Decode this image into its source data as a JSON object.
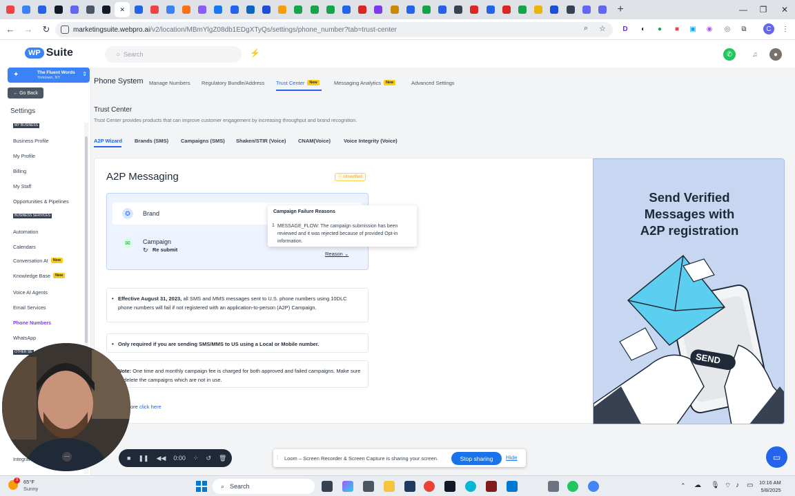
{
  "browser": {
    "url_host": "marketingsuite.webpro.ai",
    "url_path": "/v2/location/MBmYlgZ08db1EDgXTyQs/settings/phone_number?tab=trust-center",
    "tab_count": 38
  },
  "app": {
    "logo_badge": "WP",
    "logo_text": "Suite",
    "search_placeholder": "Search"
  },
  "sidebar": {
    "location_name": "The Fluent Words",
    "location_sub": "Yorktown, NY",
    "go_back": "Go Back",
    "settings_title": "Settings",
    "section_my_business": "MY BUSINESS",
    "section_business_services": "BUSINESS SERVICES",
    "section_other": "OTHER SE",
    "items": [
      {
        "label": "Business Profile"
      },
      {
        "label": "My Profile"
      },
      {
        "label": "Billing"
      },
      {
        "label": "My Staff"
      },
      {
        "label": "Opportunities & Pipelines"
      },
      {
        "label": "Automation"
      },
      {
        "label": "Calendars"
      },
      {
        "label": "Conversation AI",
        "badge": "New"
      },
      {
        "label": "Knowledge Base",
        "badge": "New"
      },
      {
        "label": "Voice AI Agents"
      },
      {
        "label": "Email Services"
      },
      {
        "label": "Phone Numbers"
      },
      {
        "label": "WhatsApp"
      },
      {
        "label": "Integrat"
      }
    ]
  },
  "main": {
    "page_title": "Phone System",
    "top_tabs": [
      {
        "label": "Manage Numbers"
      },
      {
        "label": "Regulatory Bundle/Address"
      },
      {
        "label": "Trust Center",
        "badge": "New"
      },
      {
        "label": "Messaging Analytics",
        "badge": "New"
      },
      {
        "label": "Advanced Settings"
      }
    ],
    "trust_center_title": "Trust Center",
    "trust_center_sub": "Trust Center provides products that can improve customer engagement by increasing throughput and brand recognition.",
    "sub_tabs": [
      {
        "label": "A2P Wizard"
      },
      {
        "label": "Brands (SMS)"
      },
      {
        "label": "Campaigns (SMS)"
      },
      {
        "label": "Shaken/STIR (Voice)"
      },
      {
        "label": "CNAM(Voice)"
      },
      {
        "label": "Voice Integrity (Voice)"
      }
    ],
    "a2p_title": "A2P Messaging",
    "status": "Unverified",
    "step_brand": "Brand",
    "step_campaign": "Campaign",
    "resubmit": "Re submit",
    "reason": "Reason",
    "tooltip": {
      "title": "Campaign Failure Reasons",
      "num": "1",
      "body": "MESSAGE_FLOW: The campaign submission has been reviewed and it was rejected because of provided Opt-in information."
    },
    "note1_bold": "Effective August 31, 2023,",
    "note1_rest": " all SMS and MMS messages sent to U.S. phone numbers using 10DLC phone numbers will fail if not registered with an application-to-person (A2P) Campaign.",
    "note2": "Only required if you are sending SMS/MMS to US using a Local or Mobile number.",
    "note3_bold": "Note:",
    "note3_rest": " One time and monthly campaign fee is charged for both approved and failed campaigns. Make sure to delete the campaigns which are not in use.",
    "learn_prefix": "ore",
    "learn_link": "click here",
    "promo_title_lines": [
      "Send Verified",
      "Messages with",
      "A2P registration"
    ],
    "promo_send": "SEND"
  },
  "overlay": {
    "rec_time": "0:00",
    "loom_text": "Loom – Screen Recorder & Screen Capture is sharing your screen.",
    "stop_sharing": "Stop sharing",
    "hide": "Hide"
  },
  "taskbar": {
    "temp": "65°F",
    "condition": "Sunny",
    "search": "Search",
    "time": "10:16 AM",
    "date": "5/8/2025",
    "weather_badge": "3"
  },
  "colors": {
    "accent": "#2563eb",
    "promo_bg": "#c7d7f1",
    "brand_blue": "#3b82f6",
    "active_nav": "#7c3aed"
  }
}
